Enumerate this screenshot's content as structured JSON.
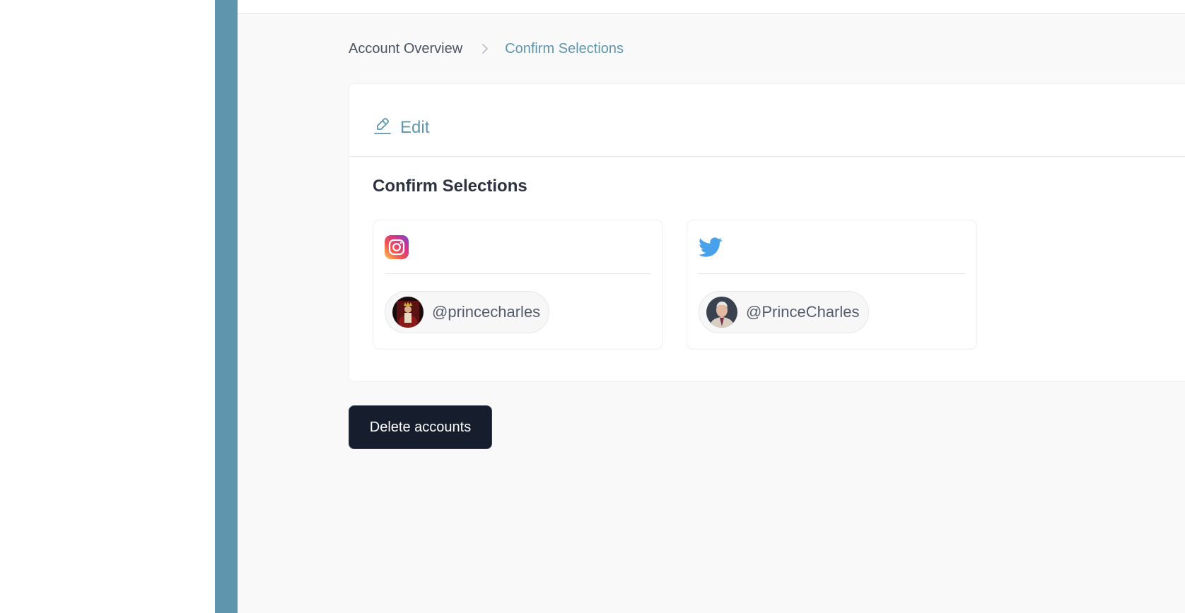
{
  "breadcrumb": {
    "previous": "Account Overview",
    "current": "Confirm Selections"
  },
  "card": {
    "edit_label": "Edit",
    "section_title": "Confirm Selections",
    "accounts": [
      {
        "platform_icon": "instagram-icon",
        "handle": "@princecharles"
      },
      {
        "platform_icon": "twitter-icon",
        "handle": "@PrinceCharles"
      }
    ]
  },
  "actions": {
    "delete_label": "Delete accounts"
  },
  "colors": {
    "accent": "#5f95ad",
    "primary_button": "#161e2e",
    "page_background": "#f9f9f9",
    "twitter_blue": "#4aa1eb"
  }
}
